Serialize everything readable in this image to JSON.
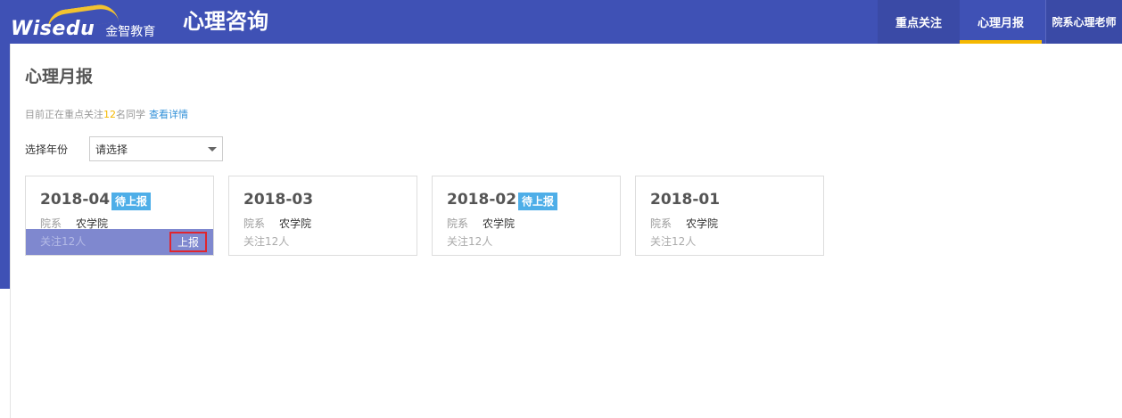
{
  "header": {
    "brand_word": "Wisedu",
    "brand_cn": "金智教育",
    "app_title": "心理咨询",
    "tabs": [
      {
        "label": "重点关注",
        "active": false
      },
      {
        "label": "心理月报",
        "active": true
      }
    ],
    "user_role": "院系心理老师"
  },
  "page": {
    "title": "心理月报",
    "info_prefix": "目前正在重点关注",
    "info_count": "12",
    "info_suffix": "名同学",
    "info_link": "查看详情",
    "year_label": "选择年份",
    "year_select_value": "请选择"
  },
  "cards": [
    {
      "month": "2018-04",
      "badge": "待上报",
      "dept_label": "院系",
      "dept_name": "农学院",
      "follow": "关注12人",
      "action": "上报"
    },
    {
      "month": "2018-03",
      "dept_label": "院系",
      "dept_name": "农学院",
      "follow": "关注12人"
    },
    {
      "month": "2018-02",
      "badge": "待上报",
      "dept_label": "院系",
      "dept_name": "农学院",
      "follow": "关注12人"
    },
    {
      "month": "2018-01",
      "dept_label": "院系",
      "dept_name": "农学院",
      "follow": "关注12人"
    }
  ],
  "colors": {
    "header_bg": "#3f51b5",
    "tab_active_underline": "#f5b800",
    "badge_bg": "#4eaee8",
    "link": "#2f8fd8",
    "highlight_count": "#f5b800",
    "card_hover_footer": "#7f88cf",
    "action_border": "#e0252e"
  }
}
